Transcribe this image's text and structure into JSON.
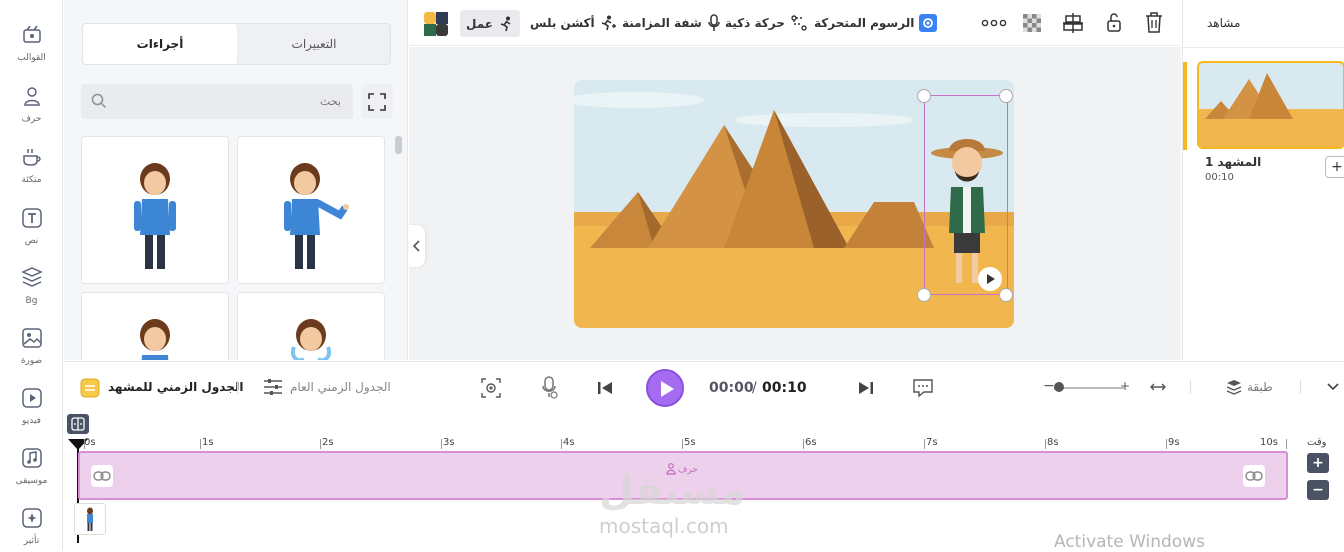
{
  "left_rail": [
    {
      "label": "القوالب",
      "icon": "templates-icon"
    },
    {
      "label": "حرف",
      "icon": "character-icon"
    },
    {
      "label": "متكئة",
      "icon": "props-icon"
    },
    {
      "label": "نص",
      "icon": "text-icon"
    },
    {
      "label": "Bg",
      "icon": "background-icon"
    },
    {
      "label": "صورة",
      "icon": "image-icon"
    },
    {
      "label": "فيديو",
      "icon": "video-icon"
    },
    {
      "label": "موسيقى",
      "icon": "music-icon"
    },
    {
      "label": "تأثير",
      "icon": "effects-icon"
    }
  ],
  "asset_panel": {
    "tab_expressions": "التعبيرات",
    "tab_actions": "أجراءات",
    "search_placeholder": "بحث"
  },
  "toolbar": {
    "work": "عمل",
    "action_plus": "أكشن بلس",
    "lip_sync": "شفة المزامنة",
    "smart_motion": "حركة ذكية",
    "animation": "الرسوم المتحركة"
  },
  "scenes": {
    "title": "مشاهد",
    "scene_name": "المشهد 1",
    "scene_duration": "00:10",
    "add_label": "+"
  },
  "timeline_controls": {
    "scene_timeline": "الجدول الزمني للمشهد",
    "global_timeline": "الجدول الزمني العام",
    "current_time": "00:00",
    "separator": "/",
    "total_time": "00:10",
    "layer_label": "طبقة"
  },
  "timeline": {
    "time_label": "وقت",
    "ticks": [
      "0s",
      "1s",
      "2s",
      "3s",
      "4s",
      "5s",
      "6s",
      "7s",
      "8s",
      "9s",
      "10s"
    ],
    "track_label": "حرف",
    "zoom_in": "+",
    "zoom_out": "−"
  },
  "watermarks": {
    "logo_text": "مستقل",
    "site": "mostaql.com",
    "windows": "Activate Windows"
  },
  "colors": {
    "accent_purple": "#a56cf2",
    "track_fill": "#edd0eb",
    "track_border": "#d88ed4",
    "scene_selected": "#f6b81f",
    "toolbar_blue": "#3b82f6"
  }
}
